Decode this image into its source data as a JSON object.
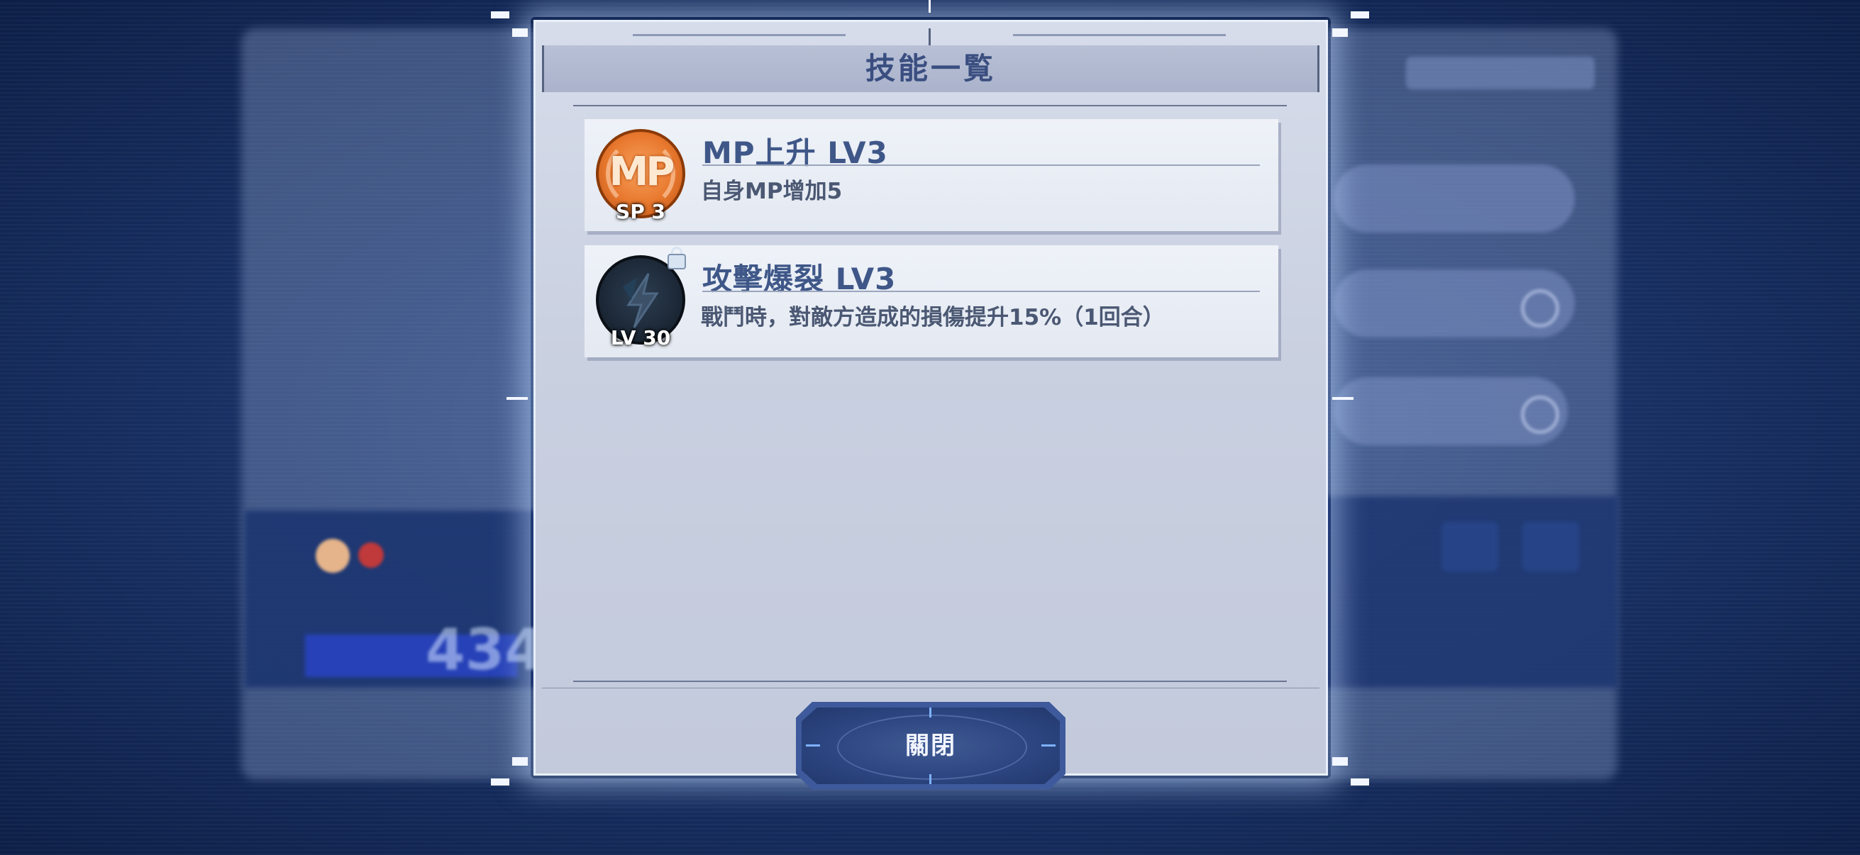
{
  "dialog": {
    "title": "技能一覧",
    "close_label": "關閉"
  },
  "skills": [
    {
      "icon": "mp-swirl-icon",
      "icon_text": "MP",
      "icon_sub": "SP 3",
      "name": "MP上升 LV3",
      "description": "自身MP增加5",
      "locked": false
    },
    {
      "icon": "lightning-icon",
      "icon_sub": "LV 30",
      "name": "攻擊爆裂 LV3",
      "description": "戰鬥時，對敵方造成的損傷提升15%（1回合）",
      "locked": true
    }
  ],
  "background": {
    "hp_value": "434"
  },
  "colors": {
    "title_text": "#3a4e80",
    "skill_name": "#3f5788",
    "mp_icon": "#e8782e",
    "button": "#2c4580"
  }
}
